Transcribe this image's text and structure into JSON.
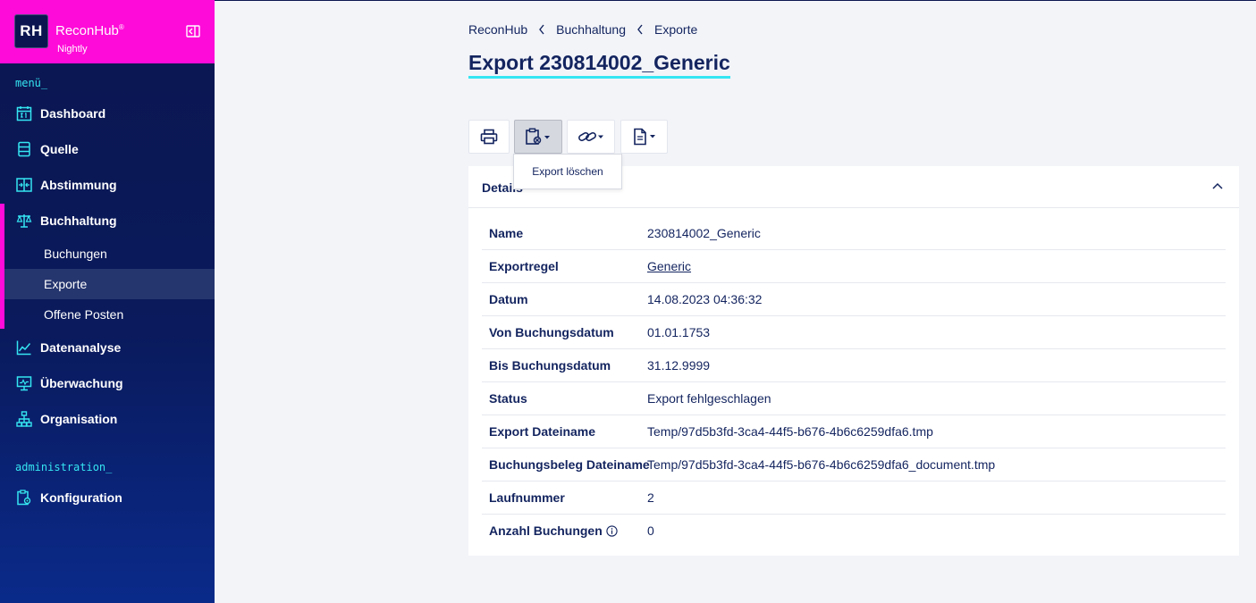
{
  "sidebar": {
    "logo_text": "RH",
    "brand_name": "ReconHub",
    "brand_mark": "®",
    "brand_sub": "Nightly",
    "section_menu": "menü_",
    "section_admin": "administration_",
    "items": [
      {
        "label": "Dashboard",
        "icon": "calendar-icon"
      },
      {
        "label": "Quelle",
        "icon": "database-icon"
      },
      {
        "label": "Abstimmung",
        "icon": "compare-icon"
      },
      {
        "label": "Buchhaltung",
        "icon": "scale-icon"
      },
      {
        "label": "Datenanalyse",
        "icon": "chart-line-icon"
      },
      {
        "label": "Überwachung",
        "icon": "monitor-icon"
      },
      {
        "label": "Organisation",
        "icon": "org-chart-icon"
      },
      {
        "label": "Konfiguration",
        "icon": "settings-clipboard-icon"
      }
    ],
    "sub_items": [
      {
        "label": "Buchungen"
      },
      {
        "label": "Exporte",
        "active": true
      },
      {
        "label": "Offene Posten"
      }
    ]
  },
  "breadcrumb": [
    "ReconHub",
    "Buchhaltung",
    "Exporte"
  ],
  "page_title": "Export 230814002_Generic",
  "toolbar": {
    "buttons": [
      "print-icon",
      "clipboard-delete-icon",
      "link-icon",
      "document-icon"
    ],
    "dropdown_item": "Export löschen"
  },
  "details": {
    "title": "Details",
    "rows": [
      {
        "key": "Name",
        "value": "230814002_Generic"
      },
      {
        "key": "Exportregel",
        "value": "Generic",
        "link": true
      },
      {
        "key": "Datum",
        "value": "14.08.2023 04:36:32"
      },
      {
        "key": "Von Buchungsdatum",
        "value": "01.01.1753"
      },
      {
        "key": "Bis Buchungsdatum",
        "value": "31.12.9999"
      },
      {
        "key": "Status",
        "value": "Export fehlgeschlagen"
      },
      {
        "key": "Export Dateiname",
        "value": "Temp/97d5b3fd-3ca4-44f5-b676-4b6c6259dfa6.tmp"
      },
      {
        "key": "Buchungsbeleg Dateiname",
        "value": "Temp/97d5b3fd-3ca4-44f5-b676-4b6c6259dfa6_document.tmp"
      },
      {
        "key": "Laufnummer",
        "value": "2"
      },
      {
        "key": "Anzahl Buchungen",
        "value": "0",
        "info": true
      }
    ]
  },
  "colors": {
    "brand_pink": "#ff0bd9",
    "sidebar_navy": "#0b1650",
    "accent_cyan": "#35e6f2",
    "text_navy": "#13245f"
  }
}
